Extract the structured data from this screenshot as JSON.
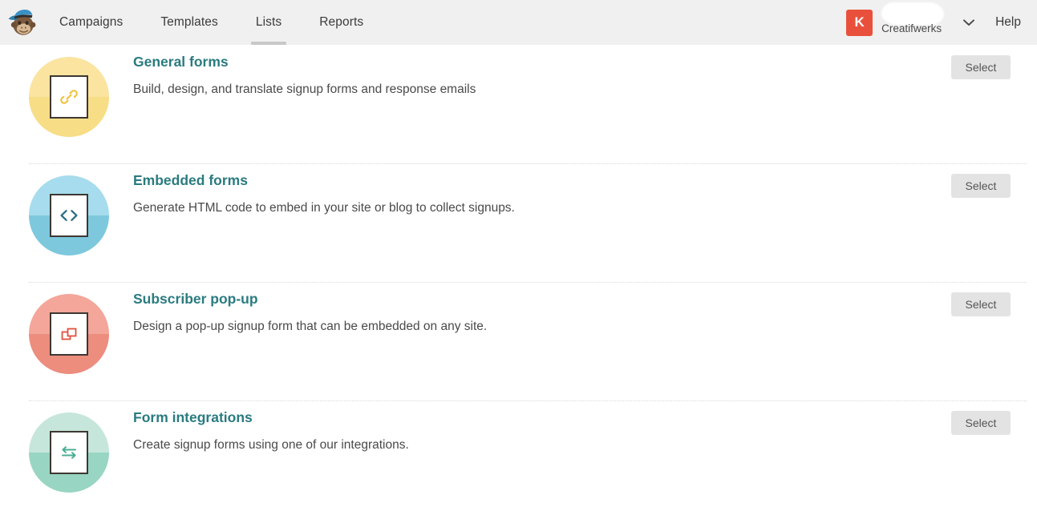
{
  "header": {
    "logo_alt": "Mailchimp Freddie logo",
    "nav": [
      {
        "label": "Campaigns",
        "active": false
      },
      {
        "label": "Templates",
        "active": false
      },
      {
        "label": "Lists",
        "active": true
      },
      {
        "label": "Reports",
        "active": false
      }
    ],
    "account": {
      "avatar_initial": "K",
      "avatar_color": "#e9503b",
      "name": "Creatifwerks",
      "username_redacted": true
    },
    "help_label": "Help",
    "background_color": "#f0f0f0"
  },
  "main": {
    "select_label": "Select",
    "rows": [
      {
        "title": "General forms",
        "description": "Build, design, and translate signup forms and response emails",
        "icon": "link-icon",
        "color_top": "#fae4a0",
        "color_bottom": "#f7dd86",
        "glyph_color": "#efc23c",
        "select_label": "Select"
      },
      {
        "title": "Embedded forms",
        "description": "Generate HTML code to embed in your site or blog to collect signups.",
        "icon": "code-brackets-icon",
        "color_top": "#a6dced",
        "color_bottom": "#7ec8dd",
        "glyph_color": "#2f6f84",
        "select_label": "Select"
      },
      {
        "title": "Subscriber pop-up",
        "description": "Design a pop-up signup form that can be embedded on any site.",
        "icon": "popup-window-icon",
        "color_top": "#f3a699",
        "color_bottom": "#ec8d7e",
        "glyph_color": "#e1503c",
        "select_label": "Select"
      },
      {
        "title": "Form integrations",
        "description": "Create signup forms using one of our integrations.",
        "icon": "exchange-arrows-icon",
        "color_top": "#c6e6db",
        "color_bottom": "#98d5c2",
        "glyph_color": "#4aad96",
        "select_label": "Select"
      }
    ]
  },
  "theme": {
    "title_color": "#2a7b7f",
    "text_color": "#4a4a4a",
    "button_bg": "#e3e3e3",
    "divider_color": "#d9d9d9"
  }
}
